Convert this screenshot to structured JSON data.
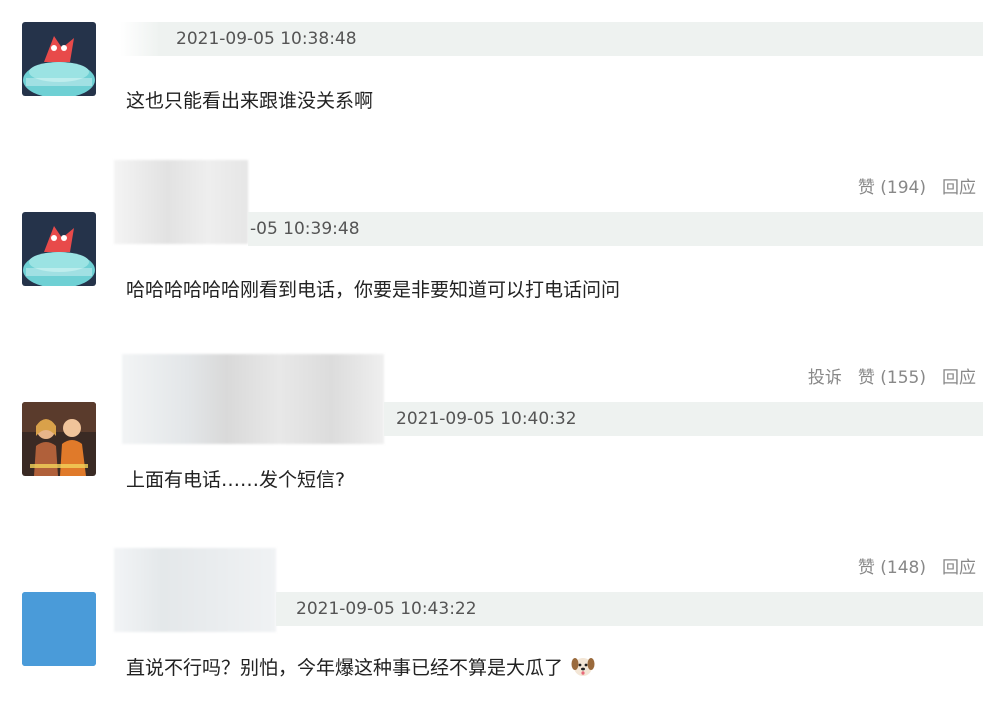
{
  "comments": [
    {
      "timestamp": "2021-09-05 10:38:48",
      "text": "这也只能看出来跟谁没关系啊",
      "avatar_icon": "cartoon-cake-avatar"
    },
    {
      "likes_label": "赞 (194)",
      "reply_label": "回应",
      "timestamp": "-05 10:39:48",
      "text": "哈哈哈哈哈哈刚看到电话，你要是非要知道可以打电话问问",
      "avatar_icon": "cartoon-cake-avatar"
    },
    {
      "report_label": "投诉",
      "likes_label": "赞 (155)",
      "reply_label": "回应",
      "timestamp": "2021-09-05 10:40:32",
      "text": "上面有电话……发个短信?",
      "avatar_icon": "photo-avatar"
    },
    {
      "likes_label": "赞 (148)",
      "reply_label": "回应",
      "timestamp": "2021-09-05 10:43:22",
      "text": "直说不行吗？别怕，今年爆这种事已经不算是大瓜了",
      "emoji": "dog-face-emoji",
      "avatar_icon": "blue-square-avatar"
    }
  ],
  "colors": {
    "meta_bar": "#eef2f0",
    "action_text": "#888888",
    "body_text": "#222222",
    "timestamp_text": "#555555"
  }
}
